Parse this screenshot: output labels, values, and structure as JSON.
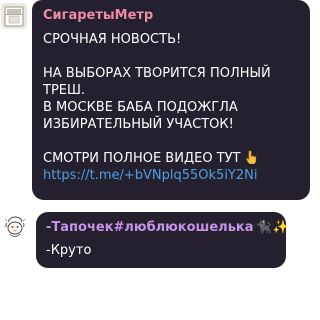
{
  "chat": {
    "message1": {
      "sender": "СигаретыМетр",
      "lines": [
        "СРОЧНАЯ НОВОСТЬ!",
        "",
        "НА ВЫБОРАХ ТВОРИТСЯ ПОЛНЫЙ",
        "ТРЕШ.",
        "В МОСКВЕ БАБА ПОДОЖГЛА",
        "ИЗБИРАТЕЛЬНЫЙ УЧАСТОК!",
        "",
        "СМОТРИ ПОЛНОЕ ВИДЕО ТУТ"
      ],
      "link": "https://t.me/+bVNplq55Ok5iY2Ni",
      "emoji_icon": "pointing-down-hand-emoji-icon"
    },
    "message2": {
      "sender": "-Тапочек#люблюкошелька",
      "sender_emojis": [
        "black-cat-icon",
        "sparkles-icon"
      ],
      "text": "-Круто"
    }
  },
  "colors": {
    "bubble_bg": "#24202e",
    "sender1": "#f08ba6",
    "sender2": "#c693e8",
    "link": "#4d9ee6",
    "text": "#ffffff"
  }
}
